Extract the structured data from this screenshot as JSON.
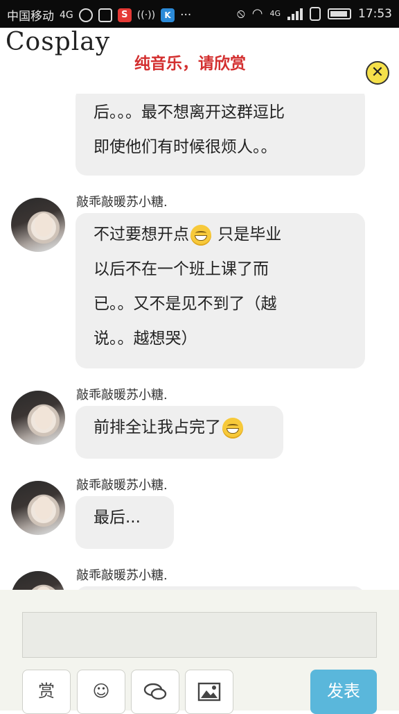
{
  "status_bar": {
    "carrier": "中国移动",
    "network": "4G",
    "network2": "4G",
    "time": "17:53",
    "icons": [
      "headset-icon",
      "gallery-icon",
      "s-app-icon",
      "wifi-hotspot-icon",
      "k-app-icon",
      "more-icon",
      "mute-icon",
      "wifi-icon",
      "signal-icon",
      "sim-icon",
      "battery-icon"
    ]
  },
  "header": {
    "title": "Cosplay",
    "marquee": "纯音乐，请欣赏",
    "close_icon": "close-icon"
  },
  "messages": [
    {
      "id": "m0",
      "username": "",
      "lines": [
        "后。。。最不想离开这群逗比",
        "即使他们有时候很烦人。。"
      ]
    },
    {
      "id": "m1",
      "username": "敲乖敲暖苏小糖.",
      "line1_a": "不过要想开点",
      "line1_b": " 只是毕业",
      "lines_rest": [
        "以后不在一个班上课了而",
        "已。。又不是见不到了（越",
        "说。。越想哭）"
      ]
    },
    {
      "id": "m2",
      "username": "敲乖敲暖苏小糖.",
      "text": "前排全让我占完了"
    },
    {
      "id": "m3",
      "username": "敲乖敲暖苏小糖.",
      "text": "最后..."
    },
    {
      "id": "m4",
      "username": "敲乖敲暖苏小糖."
    }
  ],
  "composer": {
    "reward_label": "赏",
    "send_label": "发表",
    "tools": [
      "reward-icon",
      "emoji-icon",
      "chat-bubbles-icon",
      "image-icon"
    ]
  },
  "colors": {
    "status_bar_bg": "#0b0b0b",
    "bubble_bg": "#efefef",
    "marquee_red": "#d32f2f",
    "send_blue": "#5ab7db",
    "close_yellow": "#f5e04a"
  }
}
